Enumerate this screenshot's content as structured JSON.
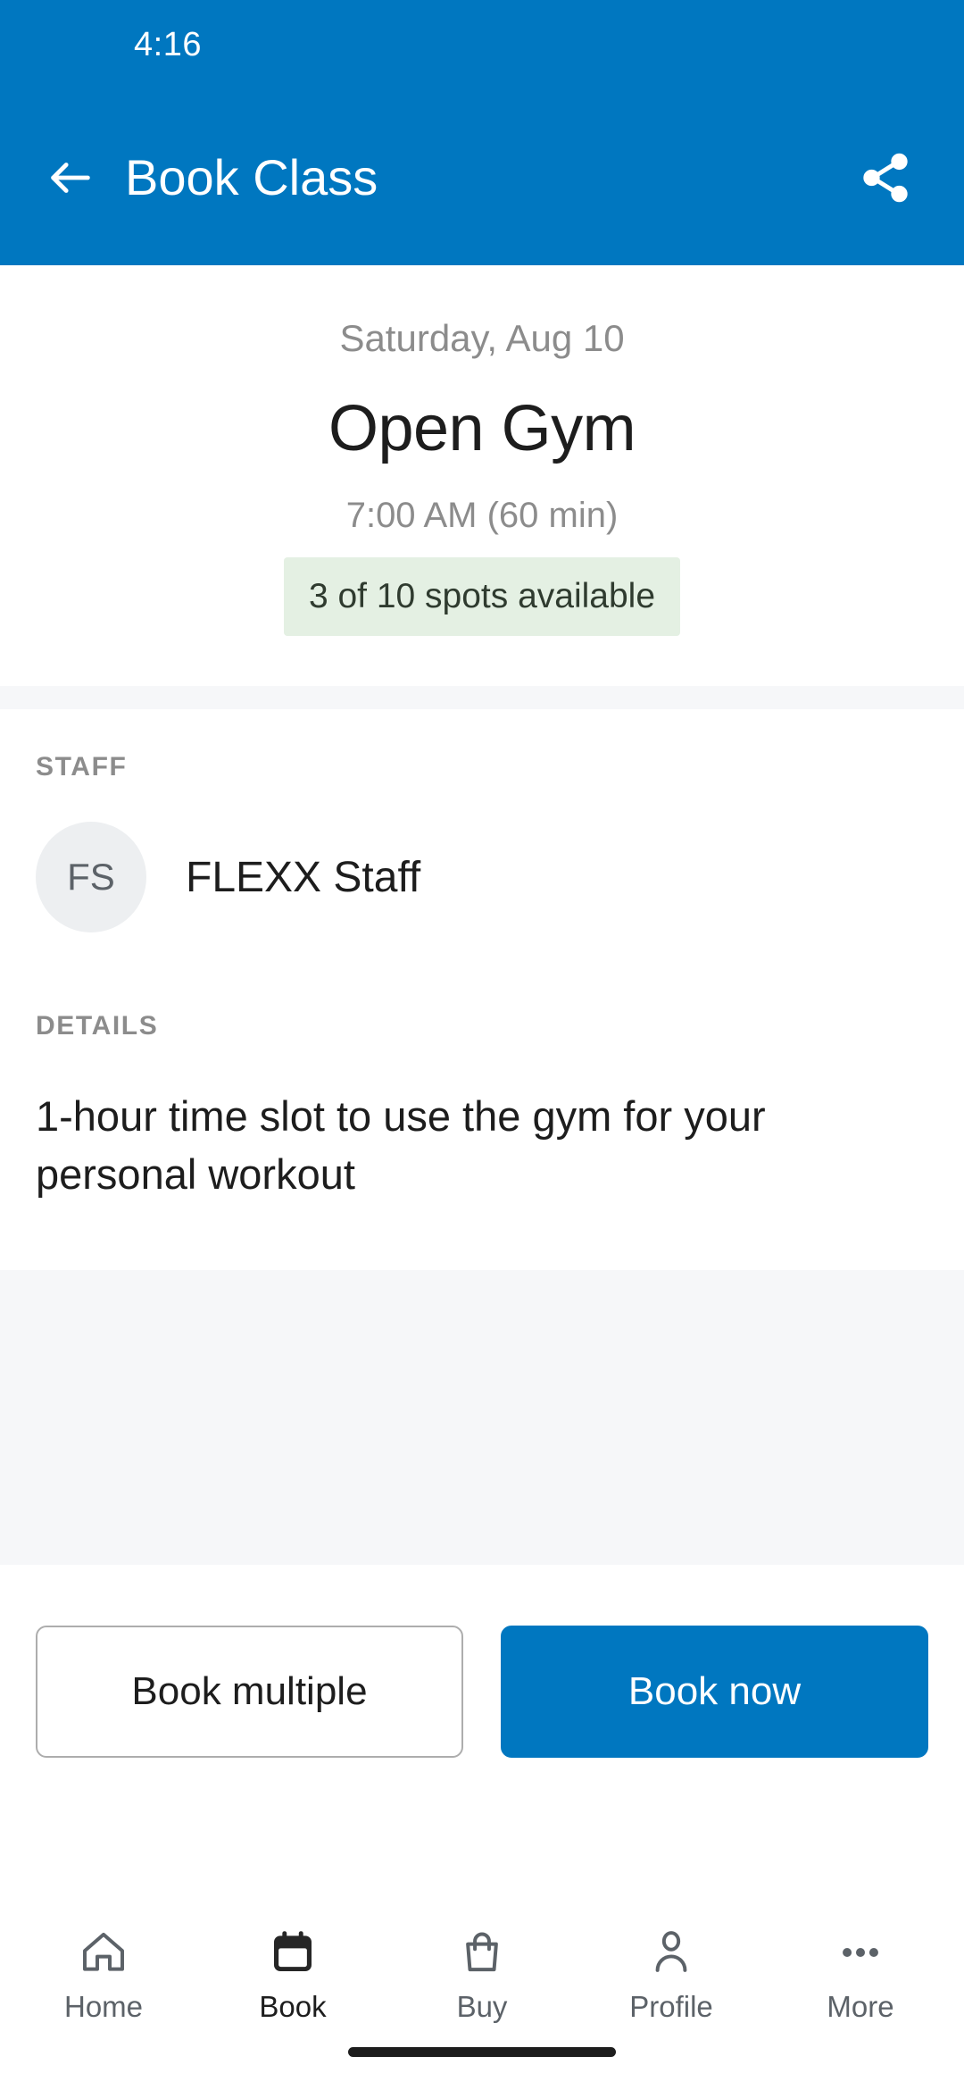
{
  "theme": {
    "primary": "#0077C0",
    "badge_bg": "#E4F0E3",
    "band_bg": "#F6F7F9",
    "avatar_bg": "#EDEFF1",
    "muted_text": "#8c8c8c",
    "body_text": "#1d1d1d"
  },
  "status_bar": {
    "time": "4:16"
  },
  "app_bar": {
    "back_icon": "arrow-left-icon",
    "title": "Book Class",
    "share_icon": "share-icon"
  },
  "class_detail": {
    "date": "Saturday, Aug 10",
    "name": "Open Gym",
    "time": "7:00 AM (60 min)",
    "availability": "3 of 10 spots available"
  },
  "staff_section": {
    "label": "STAFF",
    "avatar_initials": "FS",
    "name": "FLEXX Staff"
  },
  "details_section": {
    "label": "DETAILS",
    "text": "1-hour time slot to use the gym for your personal workout"
  },
  "actions": {
    "secondary_label": "Book multiple",
    "primary_label": "Book now"
  },
  "bottom_nav": {
    "items": [
      {
        "label": "Home",
        "icon": "home-icon",
        "active": false
      },
      {
        "label": "Book",
        "icon": "calendar-icon",
        "active": true
      },
      {
        "label": "Buy",
        "icon": "shopping-bag-icon",
        "active": false
      },
      {
        "label": "Profile",
        "icon": "person-icon",
        "active": false
      },
      {
        "label": "More",
        "icon": "more-dots-icon",
        "active": false
      }
    ]
  }
}
